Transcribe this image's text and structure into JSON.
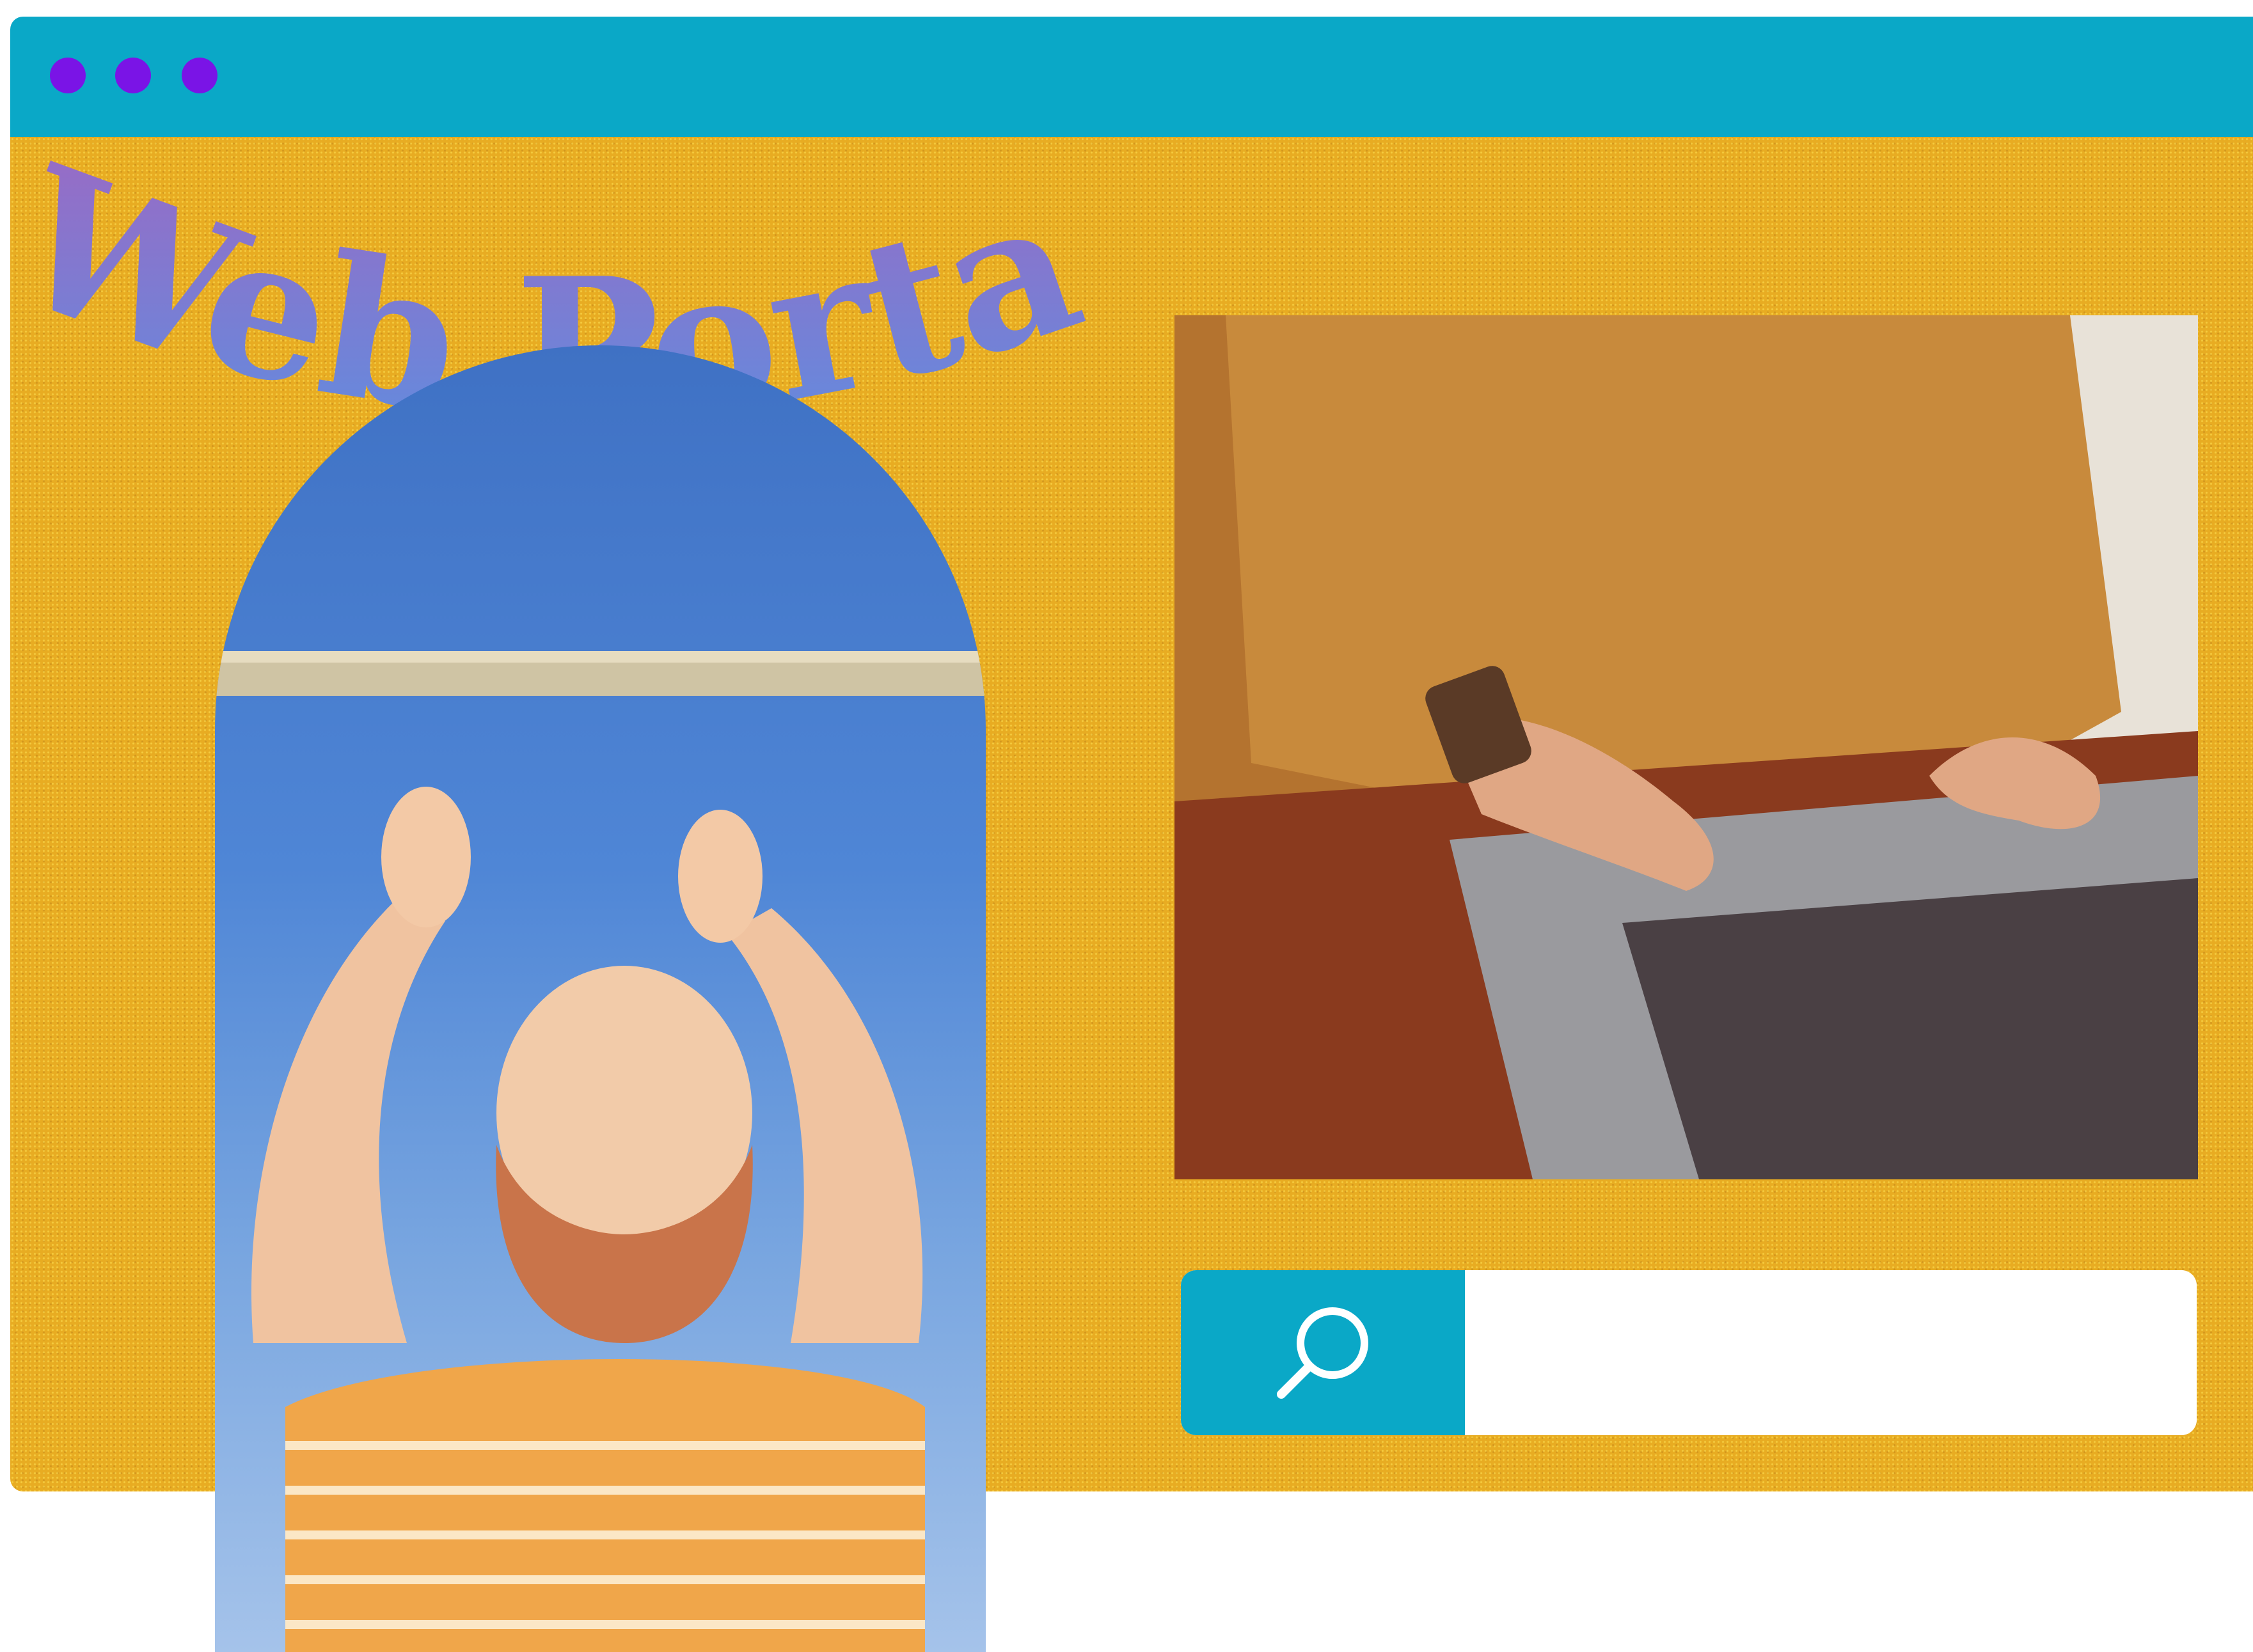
{
  "window": {
    "titlebar_color": "#0aa8c7",
    "dot_color": "#7a14e6",
    "content_color": "#e8ac22"
  },
  "hero": {
    "title": "Web Portal",
    "title_gradient_top": "#b55ab8",
    "title_gradient_bottom": "#5e8ee0"
  },
  "images": {
    "arch_photo": "woman-reaching-up-photo",
    "laptop_photo": "hands-typing-laptop-photo"
  },
  "search": {
    "icon": "search-icon",
    "value": "",
    "placeholder": ""
  }
}
